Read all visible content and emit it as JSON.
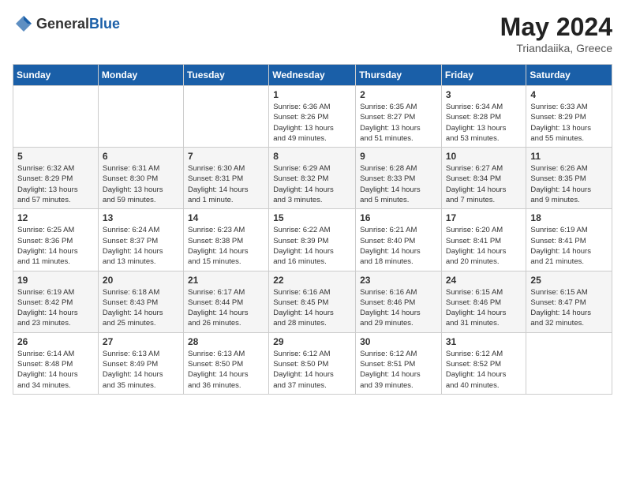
{
  "header": {
    "logo_general": "General",
    "logo_blue": "Blue",
    "title": "May 2024",
    "location": "Triandaiika, Greece"
  },
  "calendar": {
    "days_of_week": [
      "Sunday",
      "Monday",
      "Tuesday",
      "Wednesday",
      "Thursday",
      "Friday",
      "Saturday"
    ],
    "weeks": [
      [
        {
          "day": "",
          "info": ""
        },
        {
          "day": "",
          "info": ""
        },
        {
          "day": "",
          "info": ""
        },
        {
          "day": "1",
          "info": "Sunrise: 6:36 AM\nSunset: 8:26 PM\nDaylight: 13 hours\nand 49 minutes."
        },
        {
          "day": "2",
          "info": "Sunrise: 6:35 AM\nSunset: 8:27 PM\nDaylight: 13 hours\nand 51 minutes."
        },
        {
          "day": "3",
          "info": "Sunrise: 6:34 AM\nSunset: 8:28 PM\nDaylight: 13 hours\nand 53 minutes."
        },
        {
          "day": "4",
          "info": "Sunrise: 6:33 AM\nSunset: 8:29 PM\nDaylight: 13 hours\nand 55 minutes."
        }
      ],
      [
        {
          "day": "5",
          "info": "Sunrise: 6:32 AM\nSunset: 8:29 PM\nDaylight: 13 hours\nand 57 minutes."
        },
        {
          "day": "6",
          "info": "Sunrise: 6:31 AM\nSunset: 8:30 PM\nDaylight: 13 hours\nand 59 minutes."
        },
        {
          "day": "7",
          "info": "Sunrise: 6:30 AM\nSunset: 8:31 PM\nDaylight: 14 hours\nand 1 minute."
        },
        {
          "day": "8",
          "info": "Sunrise: 6:29 AM\nSunset: 8:32 PM\nDaylight: 14 hours\nand 3 minutes."
        },
        {
          "day": "9",
          "info": "Sunrise: 6:28 AM\nSunset: 8:33 PM\nDaylight: 14 hours\nand 5 minutes."
        },
        {
          "day": "10",
          "info": "Sunrise: 6:27 AM\nSunset: 8:34 PM\nDaylight: 14 hours\nand 7 minutes."
        },
        {
          "day": "11",
          "info": "Sunrise: 6:26 AM\nSunset: 8:35 PM\nDaylight: 14 hours\nand 9 minutes."
        }
      ],
      [
        {
          "day": "12",
          "info": "Sunrise: 6:25 AM\nSunset: 8:36 PM\nDaylight: 14 hours\nand 11 minutes."
        },
        {
          "day": "13",
          "info": "Sunrise: 6:24 AM\nSunset: 8:37 PM\nDaylight: 14 hours\nand 13 minutes."
        },
        {
          "day": "14",
          "info": "Sunrise: 6:23 AM\nSunset: 8:38 PM\nDaylight: 14 hours\nand 15 minutes."
        },
        {
          "day": "15",
          "info": "Sunrise: 6:22 AM\nSunset: 8:39 PM\nDaylight: 14 hours\nand 16 minutes."
        },
        {
          "day": "16",
          "info": "Sunrise: 6:21 AM\nSunset: 8:40 PM\nDaylight: 14 hours\nand 18 minutes."
        },
        {
          "day": "17",
          "info": "Sunrise: 6:20 AM\nSunset: 8:41 PM\nDaylight: 14 hours\nand 20 minutes."
        },
        {
          "day": "18",
          "info": "Sunrise: 6:19 AM\nSunset: 8:41 PM\nDaylight: 14 hours\nand 21 minutes."
        }
      ],
      [
        {
          "day": "19",
          "info": "Sunrise: 6:19 AM\nSunset: 8:42 PM\nDaylight: 14 hours\nand 23 minutes."
        },
        {
          "day": "20",
          "info": "Sunrise: 6:18 AM\nSunset: 8:43 PM\nDaylight: 14 hours\nand 25 minutes."
        },
        {
          "day": "21",
          "info": "Sunrise: 6:17 AM\nSunset: 8:44 PM\nDaylight: 14 hours\nand 26 minutes."
        },
        {
          "day": "22",
          "info": "Sunrise: 6:16 AM\nSunset: 8:45 PM\nDaylight: 14 hours\nand 28 minutes."
        },
        {
          "day": "23",
          "info": "Sunrise: 6:16 AM\nSunset: 8:46 PM\nDaylight: 14 hours\nand 29 minutes."
        },
        {
          "day": "24",
          "info": "Sunrise: 6:15 AM\nSunset: 8:46 PM\nDaylight: 14 hours\nand 31 minutes."
        },
        {
          "day": "25",
          "info": "Sunrise: 6:15 AM\nSunset: 8:47 PM\nDaylight: 14 hours\nand 32 minutes."
        }
      ],
      [
        {
          "day": "26",
          "info": "Sunrise: 6:14 AM\nSunset: 8:48 PM\nDaylight: 14 hours\nand 34 minutes."
        },
        {
          "day": "27",
          "info": "Sunrise: 6:13 AM\nSunset: 8:49 PM\nDaylight: 14 hours\nand 35 minutes."
        },
        {
          "day": "28",
          "info": "Sunrise: 6:13 AM\nSunset: 8:50 PM\nDaylight: 14 hours\nand 36 minutes."
        },
        {
          "day": "29",
          "info": "Sunrise: 6:12 AM\nSunset: 8:50 PM\nDaylight: 14 hours\nand 37 minutes."
        },
        {
          "day": "30",
          "info": "Sunrise: 6:12 AM\nSunset: 8:51 PM\nDaylight: 14 hours\nand 39 minutes."
        },
        {
          "day": "31",
          "info": "Sunrise: 6:12 AM\nSunset: 8:52 PM\nDaylight: 14 hours\nand 40 minutes."
        },
        {
          "day": "",
          "info": ""
        }
      ]
    ]
  }
}
